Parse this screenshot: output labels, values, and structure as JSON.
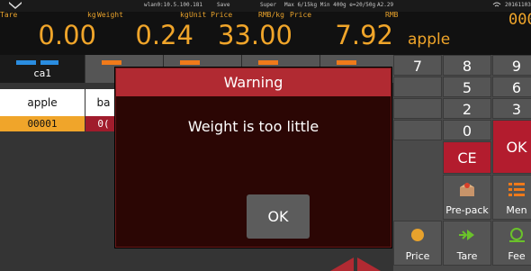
{
  "status": {
    "network": "wlan0:10.5.100.181",
    "save": "Save",
    "mode": "Super",
    "range": "Max 6/15kg Min 400g e=20/50g",
    "version": "A2.29",
    "date": "20161103"
  },
  "display": {
    "tare_label": "Tare",
    "tare_unit": "kg",
    "tare_value": "0.00",
    "weight_label": "Weight",
    "weight_unit": "kg",
    "weight_value": "0.24",
    "unit_price_label": "Unit Price",
    "unit_price_unit": "RMB/kg",
    "unit_price_value": "33.00",
    "price_label": "Price",
    "price_unit": "RMB",
    "price_value": "7.92",
    "product_name": "apple",
    "right_clipped": "000("
  },
  "categories": {
    "selected": "ca1"
  },
  "products": [
    {
      "name": "apple",
      "code": "00001"
    },
    {
      "name": "ba",
      "code": "0("
    }
  ],
  "keypad": {
    "k7": "7",
    "k8": "8",
    "k9": "9",
    "k5": "5",
    "k6": "6",
    "k2": "2",
    "k3": "3",
    "k0": "0",
    "ce": "CE",
    "ok": "OK",
    "prepack": "Pre-pack",
    "menu": "Men",
    "price": "Price",
    "tare": "Tare",
    "feed": "Fee"
  },
  "dialog": {
    "title": "Warning",
    "message": "Weight is too little",
    "ok_label": "OK"
  },
  "colors": {
    "amber": "#f0a52a",
    "dialog_header": "#b12a32",
    "dialog_body": "#2b0604",
    "keypad_red": "#b31c2e"
  }
}
